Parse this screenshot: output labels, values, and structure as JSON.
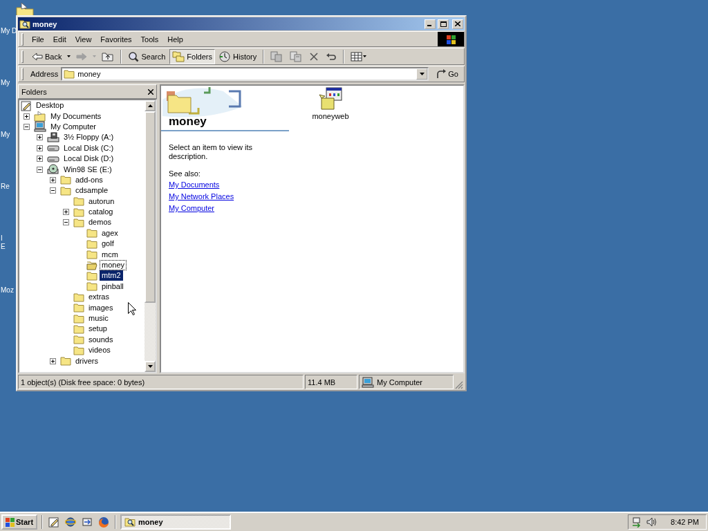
{
  "desktop_icons": [
    {
      "lines": [
        "My D"
      ]
    },
    {
      "lines": [
        "My"
      ]
    },
    {
      "lines": [
        "My"
      ]
    },
    {
      "lines": [
        "Re"
      ]
    },
    {
      "lines": [
        "I",
        "E"
      ]
    },
    {
      "lines": [
        "Moz"
      ]
    }
  ],
  "window": {
    "title": "money",
    "menu": [
      "File",
      "Edit",
      "View",
      "Favorites",
      "Tools",
      "Help"
    ],
    "toolbar": [
      {
        "kind": "back",
        "label": "Back",
        "disabled": false
      },
      {
        "kind": "forward",
        "disabled": true
      },
      {
        "kind": "up"
      },
      {
        "kind": "search",
        "label": "Search",
        "selected": false
      },
      {
        "kind": "folders",
        "label": "Folders",
        "selected": true
      },
      {
        "kind": "history",
        "label": "History",
        "selected": false
      },
      {
        "kind": "move"
      },
      {
        "kind": "copy"
      },
      {
        "kind": "delete"
      },
      {
        "kind": "undo"
      },
      {
        "kind": "views"
      }
    ],
    "address": {
      "label": "Address",
      "value": "money",
      "go": "Go"
    },
    "folders_pane": {
      "title": "Folders",
      "tree": [
        {
          "label": "Desktop",
          "kind": "desktop",
          "selected": false,
          "focused": false,
          "children": [
            {
              "label": "My Documents",
              "kind": "documents",
              "expanded": false,
              "selected": false,
              "focused": false
            },
            {
              "label": "My Computer",
              "kind": "computer",
              "expanded": true,
              "selected": false,
              "focused": false,
              "children": [
                {
                  "label": "3½ Floppy (A:)",
                  "kind": "floppy",
                  "expanded": false,
                  "selected": false,
                  "focused": false
                },
                {
                  "label": "Local Disk (C:)",
                  "kind": "disk",
                  "expanded": false,
                  "selected": false,
                  "focused": false
                },
                {
                  "label": "Local Disk (D:)",
                  "kind": "disk",
                  "expanded": false,
                  "selected": false,
                  "focused": false
                },
                {
                  "label": "Win98 SE (E:)",
                  "kind": "cd",
                  "expanded": true,
                  "selected": false,
                  "focused": false,
                  "children": [
                    {
                      "label": "add-ons",
                      "kind": "folder",
                      "expanded": false,
                      "selected": false,
                      "focused": false
                    },
                    {
                      "label": "cdsample",
                      "kind": "folder",
                      "expanded": true,
                      "selected": false,
                      "focused": false,
                      "children": [
                        {
                          "label": "autorun",
                          "kind": "folder",
                          "selected": false,
                          "focused": false
                        },
                        {
                          "label": "catalog",
                          "kind": "folder",
                          "expanded": false,
                          "selected": false,
                          "focused": false
                        },
                        {
                          "label": "demos",
                          "kind": "folder",
                          "expanded": true,
                          "selected": false,
                          "focused": false,
                          "children": [
                            {
                              "label": "agex",
                              "kind": "folder",
                              "selected": false,
                              "focused": false
                            },
                            {
                              "label": "golf",
                              "kind": "folder",
                              "selected": false,
                              "focused": false
                            },
                            {
                              "label": "mcm",
                              "kind": "folder",
                              "selected": false,
                              "focused": false
                            },
                            {
                              "label": "money",
                              "kind": "folder",
                              "selected": false,
                              "focused": true
                            },
                            {
                              "label": "mtm2",
                              "kind": "folder",
                              "selected": true,
                              "focused": false
                            },
                            {
                              "label": "pinball",
                              "kind": "folder",
                              "selected": false,
                              "focused": false
                            }
                          ]
                        },
                        {
                          "label": "extras",
                          "kind": "folder",
                          "selected": false,
                          "focused": false
                        },
                        {
                          "label": "images",
                          "kind": "folder",
                          "selected": false,
                          "focused": false
                        },
                        {
                          "label": "music",
                          "kind": "folder",
                          "selected": false,
                          "focused": false
                        },
                        {
                          "label": "setup",
                          "kind": "folder",
                          "selected": false,
                          "focused": false
                        },
                        {
                          "label": "sounds",
                          "kind": "folder",
                          "selected": false,
                          "focused": false
                        },
                        {
                          "label": "videos",
                          "kind": "folder",
                          "selected": false,
                          "focused": false
                        }
                      ]
                    },
                    {
                      "label": "drivers",
                      "kind": "folder",
                      "expanded": false,
                      "selected": false,
                      "focused": false
                    }
                  ]
                }
              ]
            }
          ]
        }
      ]
    },
    "content": {
      "title": "money",
      "description": "Select an item to view its description.",
      "see_also_label": "See also:",
      "links": [
        "My Documents",
        "My Network Places",
        "My Computer"
      ],
      "files": [
        {
          "name": "moneyweb",
          "selected": false
        }
      ]
    },
    "status_bar": {
      "objects": "1 object(s) (Disk free space: 0 bytes)",
      "size": "11.4 MB",
      "zone": "My Computer"
    }
  },
  "taskbar": {
    "start": "Start",
    "quick_launch": [
      {
        "kind": "desktop"
      },
      {
        "kind": "browser"
      },
      {
        "kind": "channels"
      },
      {
        "kind": "fox"
      }
    ],
    "tasks": [
      {
        "label": "money",
        "selected": true
      }
    ],
    "clock": "8:42 PM"
  }
}
